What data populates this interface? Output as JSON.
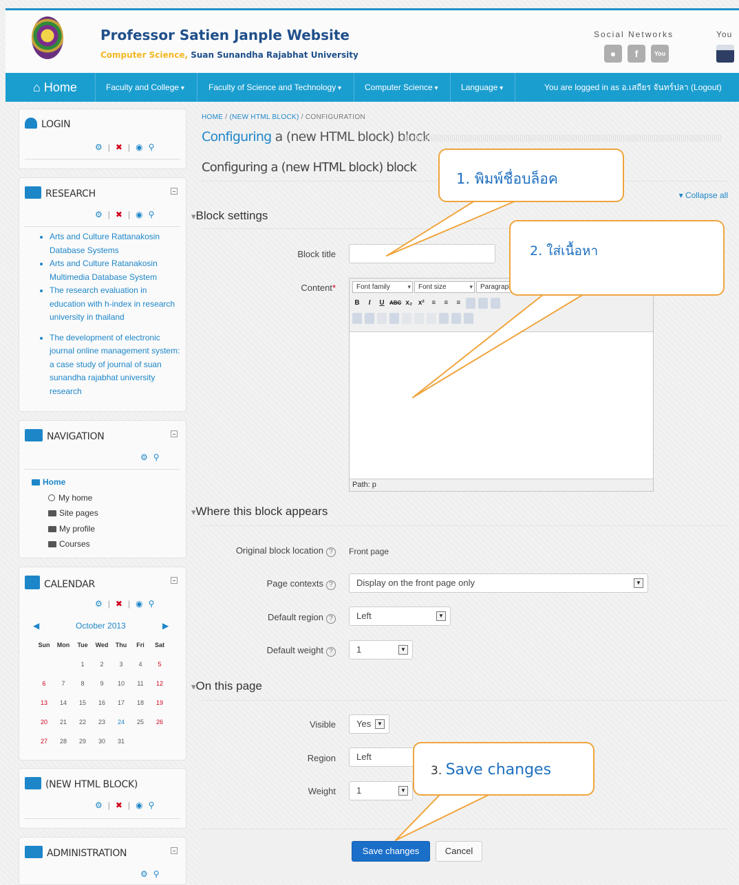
{
  "header": {
    "site_title": "Professor Satien Janple Website",
    "subtitle_part1": "Computer Science,",
    "subtitle_part2": "Suan Sunandha Rajabhat University",
    "social_label": "Social Networks",
    "you_label": "You",
    "social_icons": [
      "ok-icon",
      "facebook-icon",
      "youtube-icon"
    ],
    "social_glyphs": [
      "●",
      "f",
      "You"
    ]
  },
  "nav": {
    "home": "Home",
    "items": [
      "Faculty and College",
      "Faculty of Science and Technology",
      "Computer Science",
      "Language"
    ],
    "login_prefix": "You are logged in as ",
    "login_user": "อ.เสถียร จันทร์ปลา",
    "logout": "(Logout)"
  },
  "sidebar": {
    "login": {
      "title": "LOGIN"
    },
    "research": {
      "title": "RESEARCH",
      "items": [
        "Arts and Culture Rattanakosin Database Systems",
        "Arts and Culture Ratanakosin Multimedia Database System",
        "The research evaluation in education with h-index in research university in thailand",
        "The development of electronic journal online management system: a case study of journal of suan sunandha rajabhat university research"
      ]
    },
    "navigation": {
      "title": "NAVIGATION",
      "home": "Home",
      "items": [
        "My home",
        "Site pages",
        "My profile",
        "Courses"
      ]
    },
    "calendar": {
      "title": "CALENDAR",
      "month": "October 2013",
      "prev": "◀",
      "next": "▶",
      "days": [
        "Sun",
        "Mon",
        "Tue",
        "Wed",
        "Thu",
        "Fri",
        "Sat"
      ],
      "weeks": [
        [
          "",
          "",
          "1",
          "2",
          "3",
          "4",
          "5"
        ],
        [
          "6",
          "7",
          "8",
          "9",
          "10",
          "11",
          "12"
        ],
        [
          "13",
          "14",
          "15",
          "16",
          "17",
          "18",
          "19"
        ],
        [
          "20",
          "21",
          "22",
          "23",
          "24",
          "25",
          "26"
        ],
        [
          "27",
          "28",
          "29",
          "30",
          "31",
          "",
          ""
        ]
      ]
    },
    "new_html_block": {
      "title": "(NEW HTML BLOCK)"
    },
    "administration": {
      "title": "ADMINISTRATION"
    }
  },
  "breadcrumb": {
    "home": "HOME",
    "block": "(NEW HTML BLOCK)",
    "current": "CONFIGURATION",
    "sep": "/"
  },
  "page": {
    "title_highlight": "Configuring",
    "title_rest": " a (new HTML block) block",
    "heading": "Configuring a (new HTML block) block",
    "collapse_all": "Collapse all"
  },
  "form": {
    "block_settings": {
      "heading": "Block settings",
      "block_title_label": "Block title",
      "block_title_value": "",
      "content_label": "Content",
      "required_mark": "*",
      "editor": {
        "font_family": "Font family",
        "font_size": "Font size",
        "paragraph": "Paragraph",
        "row1": [
          "B",
          "I",
          "U",
          "ABC",
          "x₂",
          "x²",
          "≡",
          "≡",
          "≡"
        ],
        "path": "Path: p"
      }
    },
    "where": {
      "heading": "Where this block appears",
      "original_location_label": "Original block location",
      "original_location_value": "Front page",
      "page_contexts_label": "Page contexts",
      "page_contexts_value": "Display on the front page only",
      "default_region_label": "Default region",
      "default_region_value": "Left",
      "default_weight_label": "Default weight",
      "default_weight_value": "1"
    },
    "on_this_page": {
      "heading": "On this page",
      "visible_label": "Visible",
      "visible_value": "Yes",
      "region_label": "Region",
      "region_value": "Left",
      "weight_label": "Weight",
      "weight_value": "1"
    },
    "buttons": {
      "save": "Save changes",
      "cancel": "Cancel"
    }
  },
  "annotations": {
    "step1": "1.  พิมพ์ชื่อบล็อค",
    "step2": "2. ใส่เนื้อหา",
    "step3_num": "3. ",
    "step3_text": "Save changes"
  },
  "colors": {
    "accent": "#1a9ed0",
    "link": "#1d86c9",
    "callout": "#f0a43c",
    "primary_button": "#1a6fc9"
  }
}
